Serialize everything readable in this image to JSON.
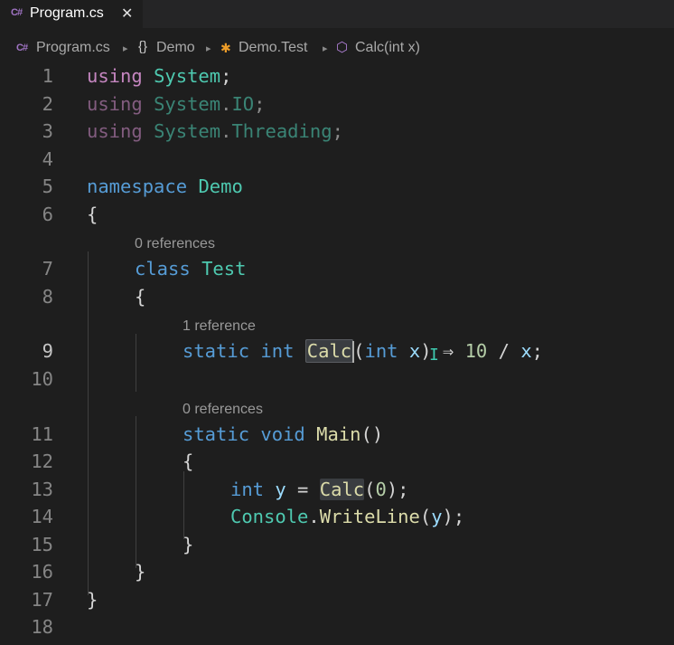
{
  "tab": {
    "icon": "C#",
    "title": "Program.cs",
    "close": "✕"
  },
  "breadcrumb": {
    "file": "Program.cs",
    "namespace": "Demo",
    "class": "Demo.Test",
    "method": "Calc(int x)",
    "separator": "▸"
  },
  "editor": {
    "line_numbers": [
      "1",
      "2",
      "3",
      "4",
      "5",
      "6",
      "7",
      "8",
      "9",
      "10",
      "11",
      "12",
      "13",
      "14",
      "15",
      "16",
      "17",
      "18"
    ],
    "active_line": "9",
    "code_lens": {
      "class_test": "0 references",
      "calc": "1 reference",
      "main": "0 references"
    },
    "tokens": {
      "using": "using",
      "system": "System",
      "io": "IO",
      "threading": "Threading",
      "namespace_kw": "namespace",
      "demo": "Demo",
      "class_kw": "class",
      "test": "Test",
      "static_kw": "static",
      "int_kw": "int",
      "void_kw": "void",
      "calc": "Calc",
      "main": "Main",
      "x": "x",
      "y": "y",
      "ten": "10",
      "zero": "0",
      "console": "Console",
      "writeline": "WriteLine",
      "arrow": "⇒",
      "open_brace": "{",
      "close_brace": "}"
    }
  }
}
